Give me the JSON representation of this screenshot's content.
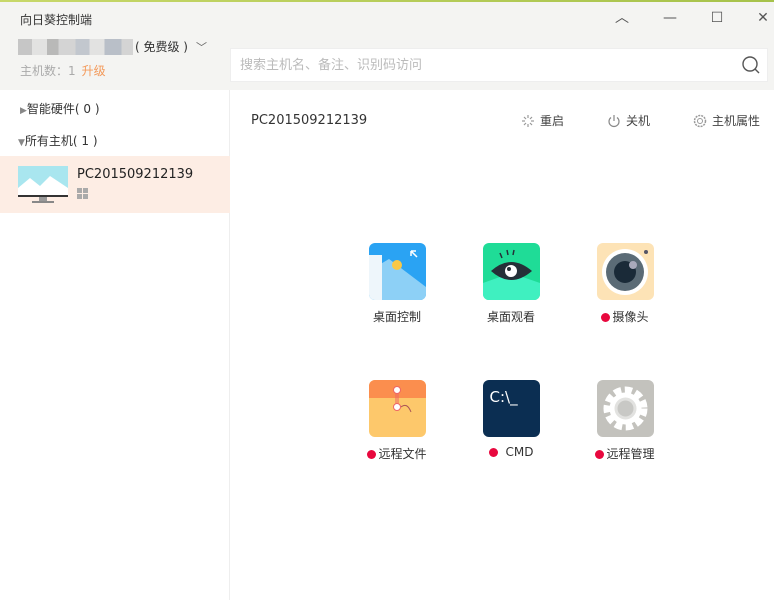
{
  "window": {
    "title": "向日葵控制端",
    "buttons": [
      "collapse",
      "minimize",
      "maximize",
      "close"
    ]
  },
  "account": {
    "tier": "( 免费级 )",
    "host_count_label": "主机数：1",
    "upgrade": "升级"
  },
  "search": {
    "placeholder": "搜索主机名、备注、识别码访问"
  },
  "sidebar": {
    "groups": [
      {
        "label": "智能硬件( 0 )",
        "expanded": false
      },
      {
        "label": "所有主机( 1 )",
        "expanded": true
      }
    ],
    "hosts": [
      {
        "name": "PC201509212139",
        "os": "windows",
        "selected": true
      }
    ]
  },
  "main": {
    "host_title": "PC201509212139",
    "actions": [
      {
        "label": "重启",
        "icon": "restart-icon"
      },
      {
        "label": "关机",
        "icon": "power-icon"
      },
      {
        "label": "主机属性",
        "icon": "settings-icon"
      }
    ],
    "tiles": [
      {
        "label": "桌面控制",
        "dot": false
      },
      {
        "label": "桌面观看",
        "dot": false
      },
      {
        "label": "摄像头",
        "dot": true
      },
      {
        "label": "远程文件",
        "dot": true
      },
      {
        "label": "CMD",
        "dot": true,
        "icon_text": "C:\\_"
      },
      {
        "label": "远程管理",
        "dot": true
      }
    ]
  },
  "colors": {
    "accent": "#f39a5b",
    "selected_bg": "#fdede4",
    "status_dot": "#e8083e"
  }
}
